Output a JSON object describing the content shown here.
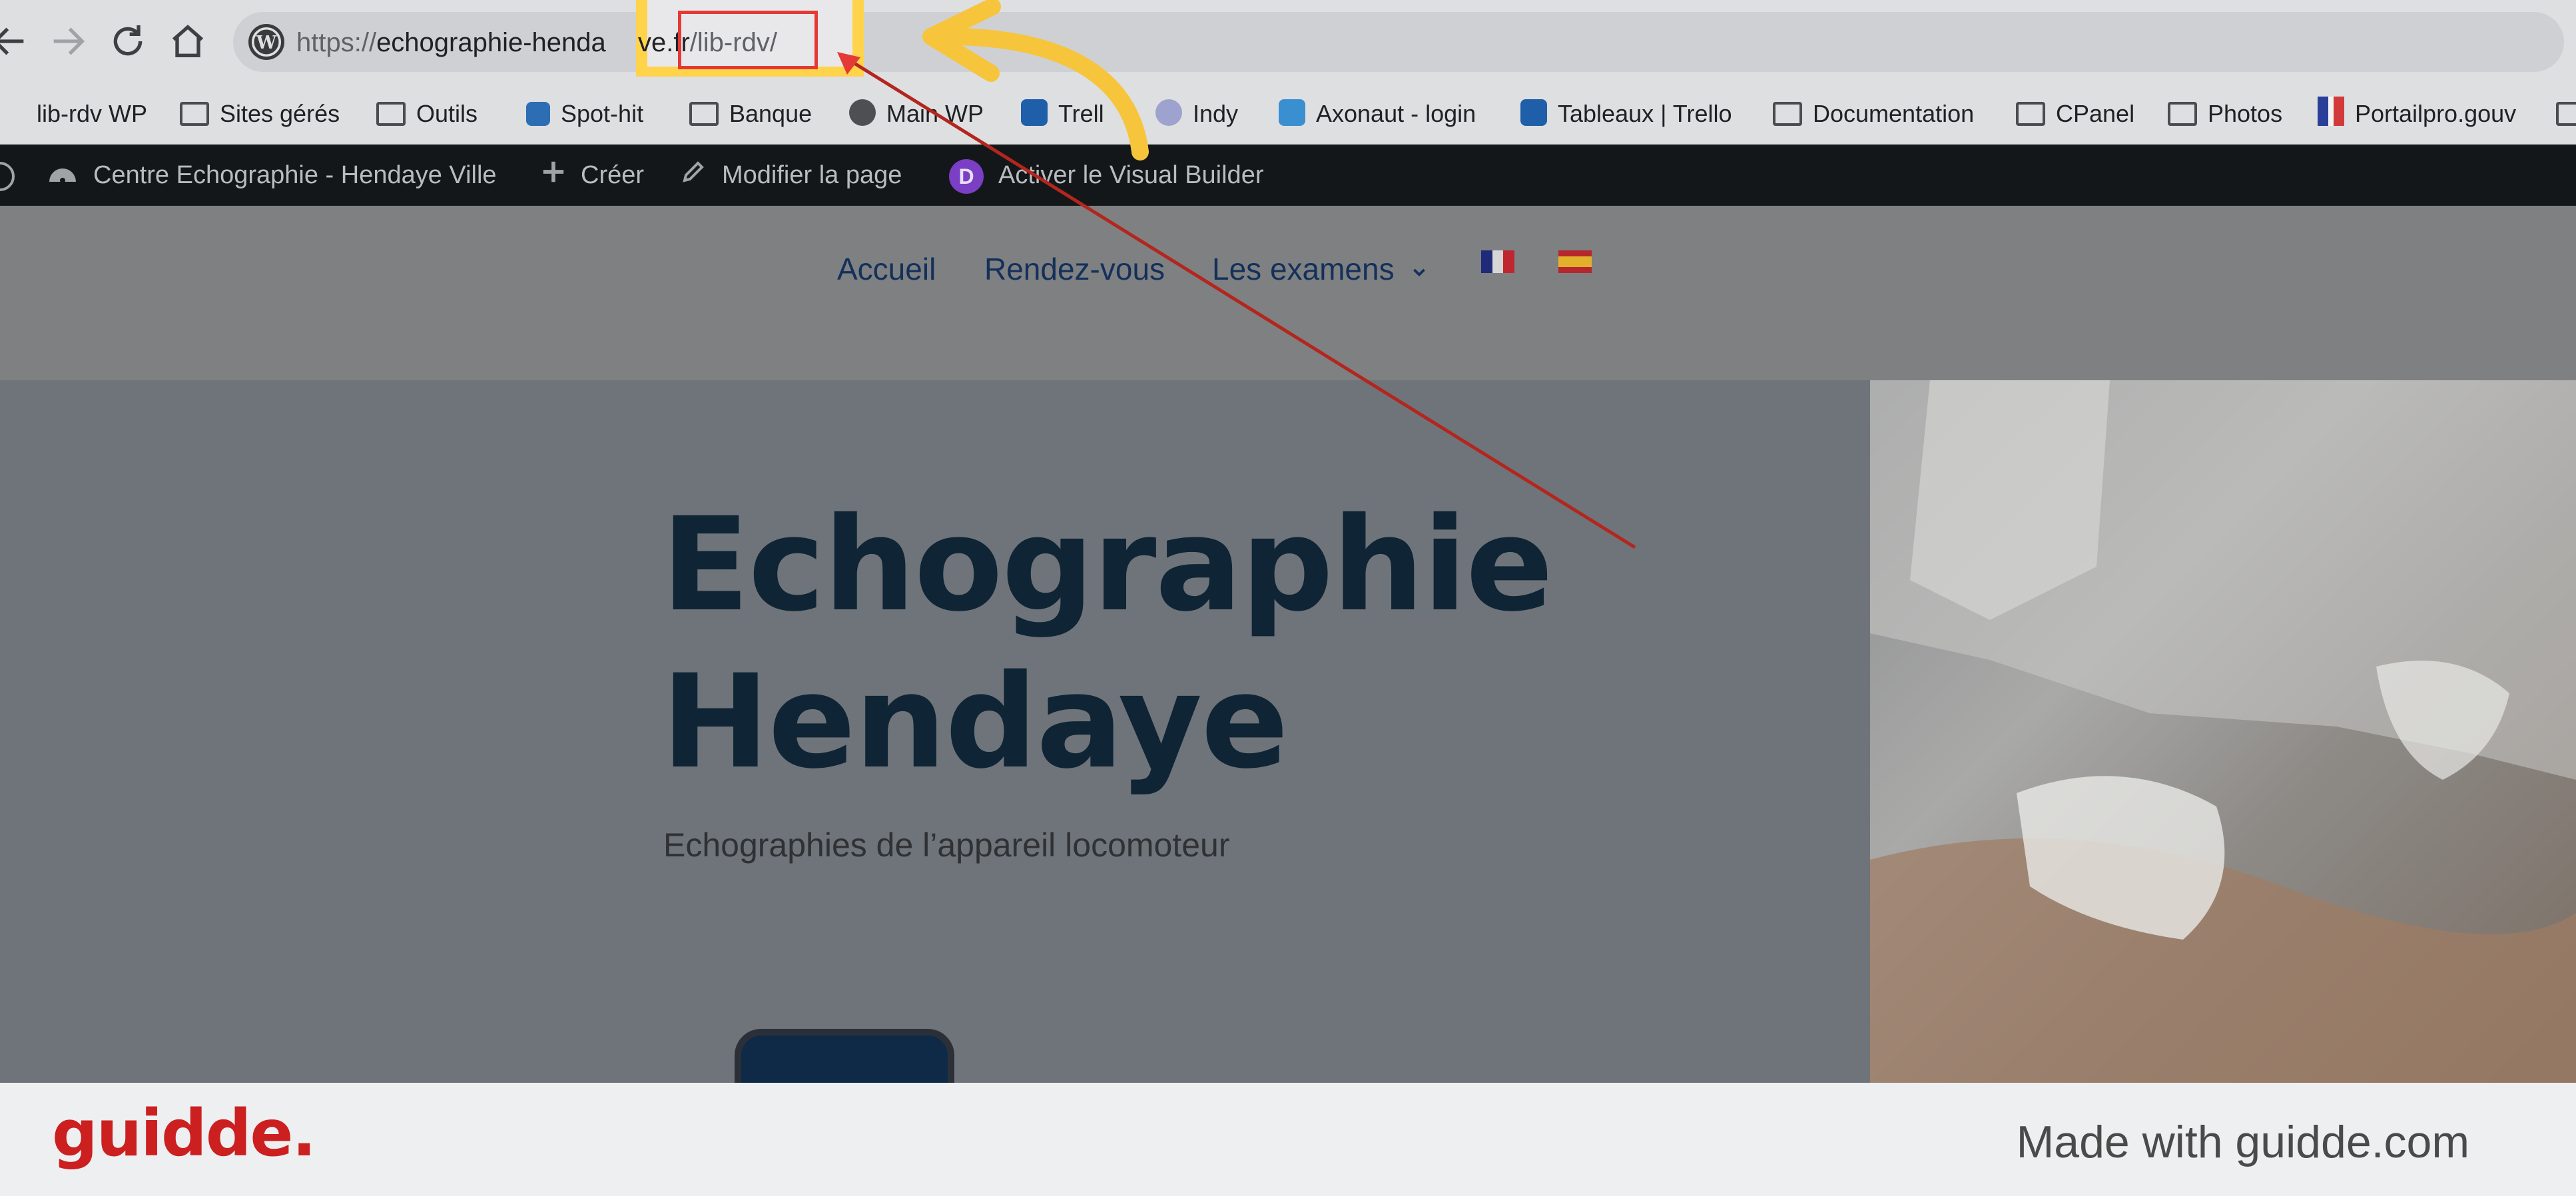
{
  "browser": {
    "url_scheme": "https://",
    "url_domain": "echographie-henda",
    "url_domain_tail": "ve.fr",
    "url_path": "/lib-rdv/"
  },
  "bookmarks": [
    {
      "label": "lib-rdv WP",
      "icon": "folder-icon"
    },
    {
      "label": "Sites gérés",
      "icon": "folder-icon"
    },
    {
      "label": "Outils",
      "icon": "folder-icon"
    },
    {
      "label": "Spot-hit",
      "icon": "spot-hit-icon"
    },
    {
      "label": "Banque",
      "icon": "folder-icon"
    },
    {
      "label": "Main WP",
      "icon": "wordpress-icon"
    },
    {
      "label": "Trell",
      "icon": "trello-icon"
    },
    {
      "label": "Indy",
      "icon": "indy-icon"
    },
    {
      "label": "Axonaut - login",
      "icon": "axonaut-icon"
    },
    {
      "label": "Tableaux | Trello",
      "icon": "trello-icon"
    },
    {
      "label": "Documentation",
      "icon": "folder-icon"
    },
    {
      "label": "CPanel",
      "icon": "folder-icon"
    },
    {
      "label": "Photos",
      "icon": "folder-icon"
    },
    {
      "label": "Portailpro.gouv",
      "icon": "marianne-icon"
    }
  ],
  "admin_bar": {
    "site_name": "Centre Echographie - Hendaye Ville",
    "create": "Créer",
    "edit_page": "Modifier la page",
    "visual_builder": "Activer le Visual Builder",
    "divi_badge": "D"
  },
  "menu": {
    "home": "Accueil",
    "appointments": "Rendez-vous",
    "exams": "Les examens"
  },
  "hero": {
    "title_line1": "Echographie",
    "title_line2": "Hendaye",
    "subtitle": "Echographies de l’appareil locomoteur"
  },
  "footer": {
    "logo": "guidde.",
    "tagline": "Made with guidde.com"
  },
  "colors": {
    "highlight": "#ffd34a",
    "red_box": "#e53935",
    "arrow": "#f6c53c",
    "footer_logo": "#cc1f1f",
    "menu_text": "#14305a",
    "hero_title": "#0f2434"
  }
}
